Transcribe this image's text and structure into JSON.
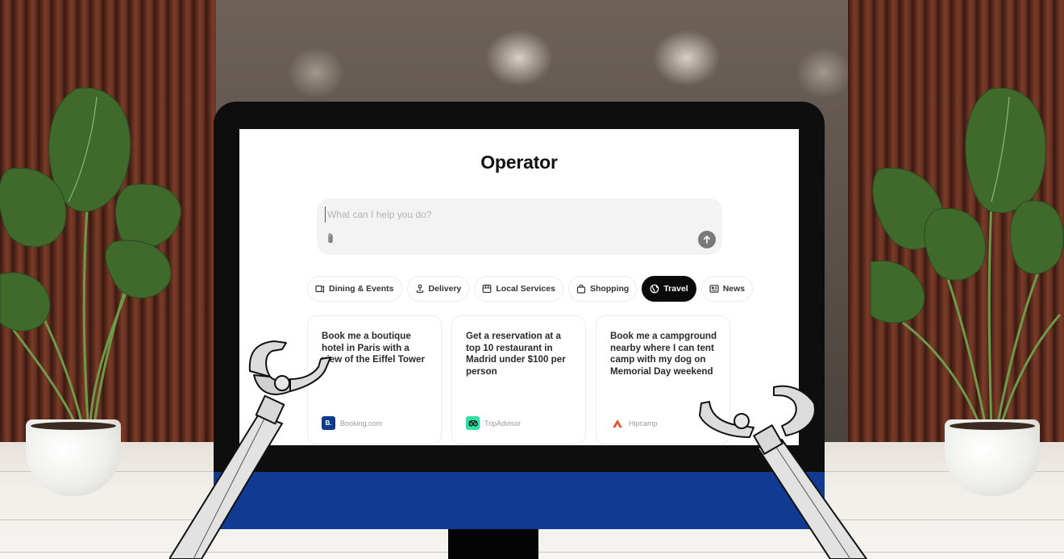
{
  "app": {
    "title": "Operator"
  },
  "prompt": {
    "placeholder": "What can I help you do?",
    "value": "",
    "attach_icon": "paperclip-icon",
    "send_icon": "arrow-up-icon"
  },
  "categories": [
    {
      "label": "Dining & Events",
      "icon": "dining-events-icon",
      "active": false
    },
    {
      "label": "Delivery",
      "icon": "delivery-icon",
      "active": false
    },
    {
      "label": "Local Services",
      "icon": "storefront-icon",
      "active": false
    },
    {
      "label": "Shopping",
      "icon": "shopping-bag-icon",
      "active": false
    },
    {
      "label": "Travel",
      "icon": "globe-icon",
      "active": true
    },
    {
      "label": "News",
      "icon": "newspaper-icon",
      "active": false
    }
  ],
  "suggestions": [
    {
      "text": "Book me a boutique hotel in Paris with a view of the Eiffel Tower",
      "source": "Booking.com",
      "logo_letter": "B.",
      "logo_color": "#0d3b8e"
    },
    {
      "text": "Get a reservation at a top 10 restaurant in Madrid under $100 per person",
      "source": "TripAdvisor",
      "logo_letter": "",
      "logo_color": "#34e0a1"
    },
    {
      "text": "Book me a campground nearby where I can tent camp with my dog on Memorial Day weekend",
      "source": "Hipcamp",
      "logo_letter": "",
      "logo_color": "#e4572e"
    }
  ],
  "colors": {
    "monitor_frame": "#0e0e0e",
    "monitor_chin": "#113a92",
    "active_chip": "#0b0b0b",
    "send_button": "#7a7a7a"
  }
}
